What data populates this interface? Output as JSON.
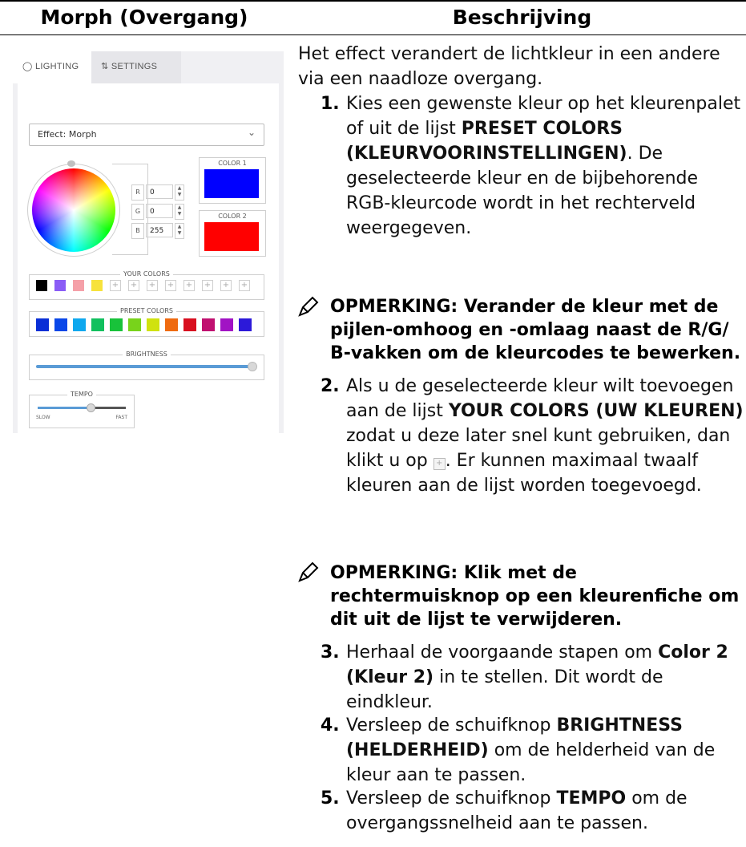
{
  "table_header": {
    "left": "Morph (Overgang)",
    "right": "Beschrijving"
  },
  "ui": {
    "tab_lighting": "LIGHTING",
    "tab_settings": "SETTINGS",
    "effect_value": "Effect: Morph",
    "rgb": {
      "r_label": "R",
      "r_value": "0",
      "g_label": "G",
      "g_value": "0",
      "b_label": "B",
      "b_value": "255"
    },
    "color1_label": "COLOR 1",
    "color1_hex": "#0000ff",
    "color2_label": "COLOR 2",
    "color2_hex": "#ff0000",
    "your_colors_label": "YOUR COLORS",
    "your_colors": [
      "#000000",
      "#8a5cf6",
      "#f5a0a8",
      "#f7e23c"
    ],
    "your_colors_empty_slots": 8,
    "preset_colors_label": "PRESET COLORS",
    "preset_colors": [
      "#0a2fd6",
      "#0a47e8",
      "#0fa8ee",
      "#11c05e",
      "#18c23a",
      "#78d31b",
      "#d0e20f",
      "#ef6a10",
      "#d80f1f",
      "#c01070",
      "#a113c4",
      "#2c19d9"
    ],
    "brightness_label": "BRIGHTNESS",
    "brightness_level": 1.0,
    "tempo_label": "TEMPO",
    "tempo_slow": "SLOW",
    "tempo_fast": "FAST",
    "tempo_level": 0.6
  },
  "desc": {
    "intro": "Het effect verandert de lichtkleur in een andere via een naadloze overgang.",
    "s1_num": "1.",
    "s1_pre": "Kies een gewenste kleur op het kleurenpalet of uit de lijst",
    "s1_b1": "PRESET COLORS (KLEURVOORINSTELLINGEN)",
    "s1_post": ". De geselecteerde kleur en de bijbehorende RGB-kleurcode wordt in het rechterveld weergegeven.",
    "note1": "OPMERKING: Verander de kleur met de pijlen-omhoog en -omlaag naast de R/G/ B-vakken om de kleurcodes te bewerken.",
    "s2_num": "2.",
    "s2_pre": "Als u de geselecteerde kleur wilt toevoegen aan de lijst",
    "s2_b1": "YOUR COLORS (UW KLEUREN)",
    "s2_mid": "zodat u deze later snel kunt gebruiken, dan klikt u op",
    "s2_post": ". Er kunnen maximaal twaalf kleuren aan de lijst worden toegevoegd.",
    "note2": "OPMERKING: Klik met de rechtermuisknop op een kleurenfiche om dit uit de lijst te verwijderen.",
    "s3_num": "3.",
    "s3_pre": "Herhaal de voorgaande stapen om",
    "s3_b1": "Color 2 (Kleur 2)",
    "s3_post": "in te stellen. Dit wordt de eindkleur.",
    "s4_num": "4.",
    "s4_pre": "Versleep de schuifknop",
    "s4_b1": "BRIGHTNESS (HELDERHEID)",
    "s4_post": "om de helderheid van de kleur aan te passen.",
    "s5_num": "5.",
    "s5_pre": "Versleep de schuifknop",
    "s5_b1": "TEMPO",
    "s5_post": "om de overgangssnelheid aan te passen."
  }
}
